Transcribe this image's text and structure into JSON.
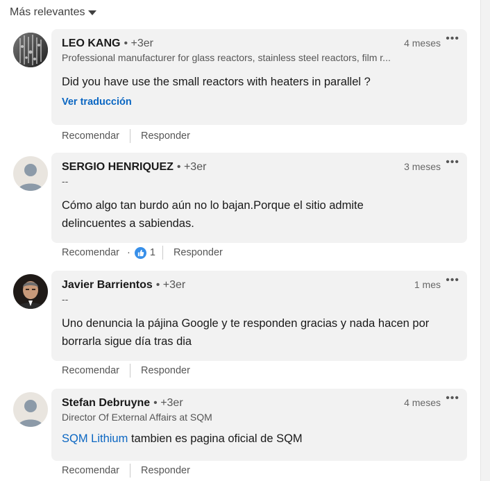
{
  "sort": {
    "label": "Más relevantes"
  },
  "actions": {
    "like": "Recomendar",
    "reply": "Responder",
    "more": "•••",
    "dot_sep": "·"
  },
  "comments": [
    {
      "name": "LEO KANG",
      "degree": "• +3er",
      "time": "4 meses",
      "headline": "Professional manufacturer for glass reactors, stainless steel reactors, film r...",
      "text": "Did you have use the small reactors with heaters in parallel ?",
      "translate": "Ver traducción"
    },
    {
      "name": "SERGIO HENRIQUEZ",
      "degree": "• +3er",
      "time": "3 meses",
      "headline": "--",
      "text": "Cómo algo tan burdo aún no lo bajan.Porque el sitio admite delincuentes a sabiendas.",
      "reaction_count": "1"
    },
    {
      "name": "Javier Barrientos",
      "degree": "• +3er",
      "time": "1 mes",
      "headline": "--",
      "text": "Uno denuncia la pájina Google  y te responden gracias y nada hacen por borrarla sigue día tras dia"
    },
    {
      "name": "Stefan Debruyne",
      "degree": "• +3er",
      "time": "4 meses",
      "headline": "Director Of External Affairs at SQM",
      "mention": "SQM Lithium",
      "text_after_mention": " tambien es pagina oficial de SQM"
    }
  ],
  "colors": {
    "accent": "#0a66c2",
    "bubble": "#f2f2f2",
    "like_icon": "#378fe9"
  }
}
